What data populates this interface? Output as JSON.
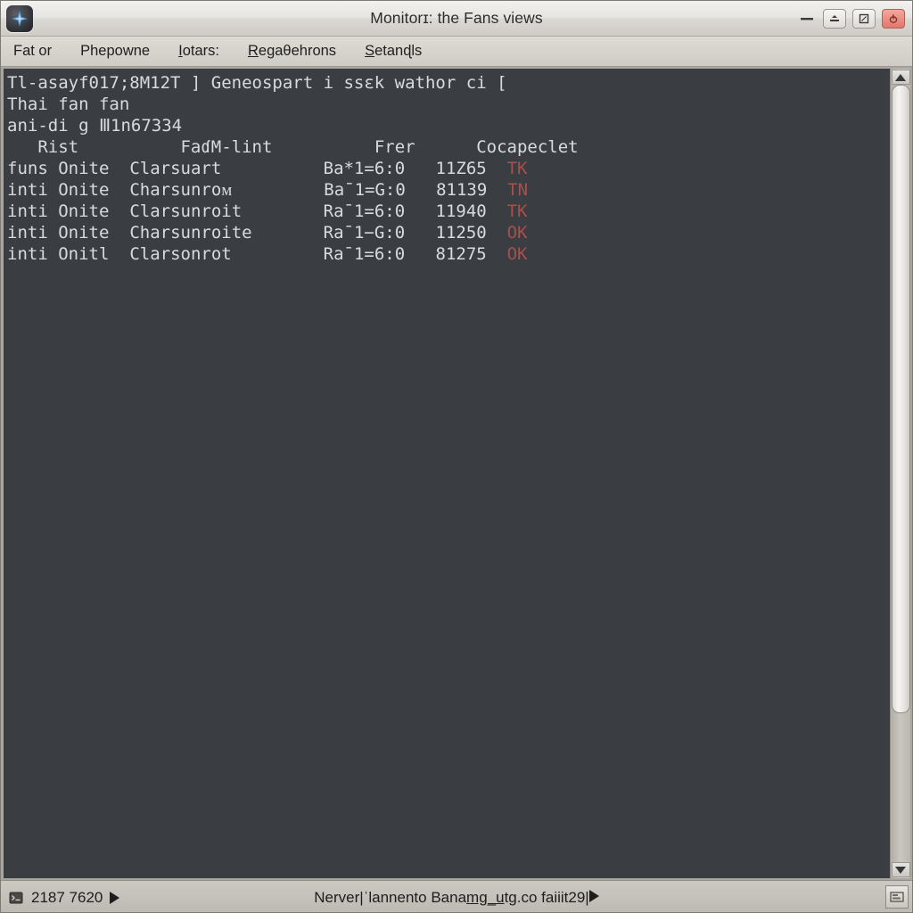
{
  "window": {
    "title": "Monitorɪ: the Fans views",
    "app_icon": "compass-star-icon",
    "buttons": {
      "minimize": "minimize-icon",
      "restore": "restore-icon",
      "maximize": "maximize-icon",
      "close": "close-icon"
    }
  },
  "menubar": {
    "items": [
      {
        "name": "menu-file",
        "pre": "Fat or",
        "mnemonic": "",
        "post": ""
      },
      {
        "name": "menu-phepowne",
        "pre": "Phepowne",
        "mnemonic": "",
        "post": ""
      },
      {
        "name": "menu-iotars",
        "pre": "",
        "mnemonic": "I",
        "post": "otars:"
      },
      {
        "name": "menu-regasehrons",
        "pre": "",
        "mnemonic": "R",
        "post": "egaθehrons"
      },
      {
        "name": "menu-setands",
        "pre": "",
        "mnemonic": "S",
        "post": "etanɖls"
      }
    ]
  },
  "terminal": {
    "background": "#3a3e43",
    "foreground": "#d9dadb",
    "status_color": "#a8504b",
    "lines": [
      "Tl-asayf017;8M12T ] Geneospart i ssɛk wathor ci [",
      "Thai fan fan",
      "ani-di g Ⅲ1n67334"
    ],
    "columns": {
      "c1": "Rist",
      "c2": "FaɗM-lint",
      "c3": "Frer",
      "c4": "Cocapeclet"
    },
    "rows": [
      {
        "c0": "funs",
        "c1": "Onite",
        "c2": "Clarsuart",
        "c3": "Ba*1=6:0",
        "c4": "11Z65",
        "status": "TK"
      },
      {
        "c0": "inti",
        "c1": "Onite",
        "c2": "Charsunroᴍ",
        "c3": "Ba¯1=G:0",
        "c4": "81139",
        "status": "TN"
      },
      {
        "c0": "inti",
        "c1": "Onite",
        "c2": "Clarsunroit",
        "c3": "Ra¯1=6:0",
        "c4": "11940",
        "status": "TK"
      },
      {
        "c0": "inti",
        "c1": "Onite",
        "c2": "Charsunroite",
        "c3": "Ra¯1−G:0",
        "c4": "11250",
        "status": "OK"
      },
      {
        "c0": "inti",
        "c1": "Onitl",
        "c2": "Clarsonrot",
        "c3": "Ra¯1=6:0",
        "c4": "81275",
        "status": "OK"
      }
    ]
  },
  "scrollbar": {
    "up_arrow": "scroll-up-icon",
    "down_arrow": "scroll-down-icon"
  },
  "statusbar": {
    "left_icon": "terminal-icon",
    "left_text": "2187 7620",
    "left_arrow": "play-triangle-icon",
    "center_pre": "Nerver|ˈlannento Bana",
    "center_mnemonic": "mg_u",
    "center_post": "tg.co faiiit29|",
    "center_arrow": "play-triangle-icon",
    "resize_grip": "resize-grip-icon"
  }
}
